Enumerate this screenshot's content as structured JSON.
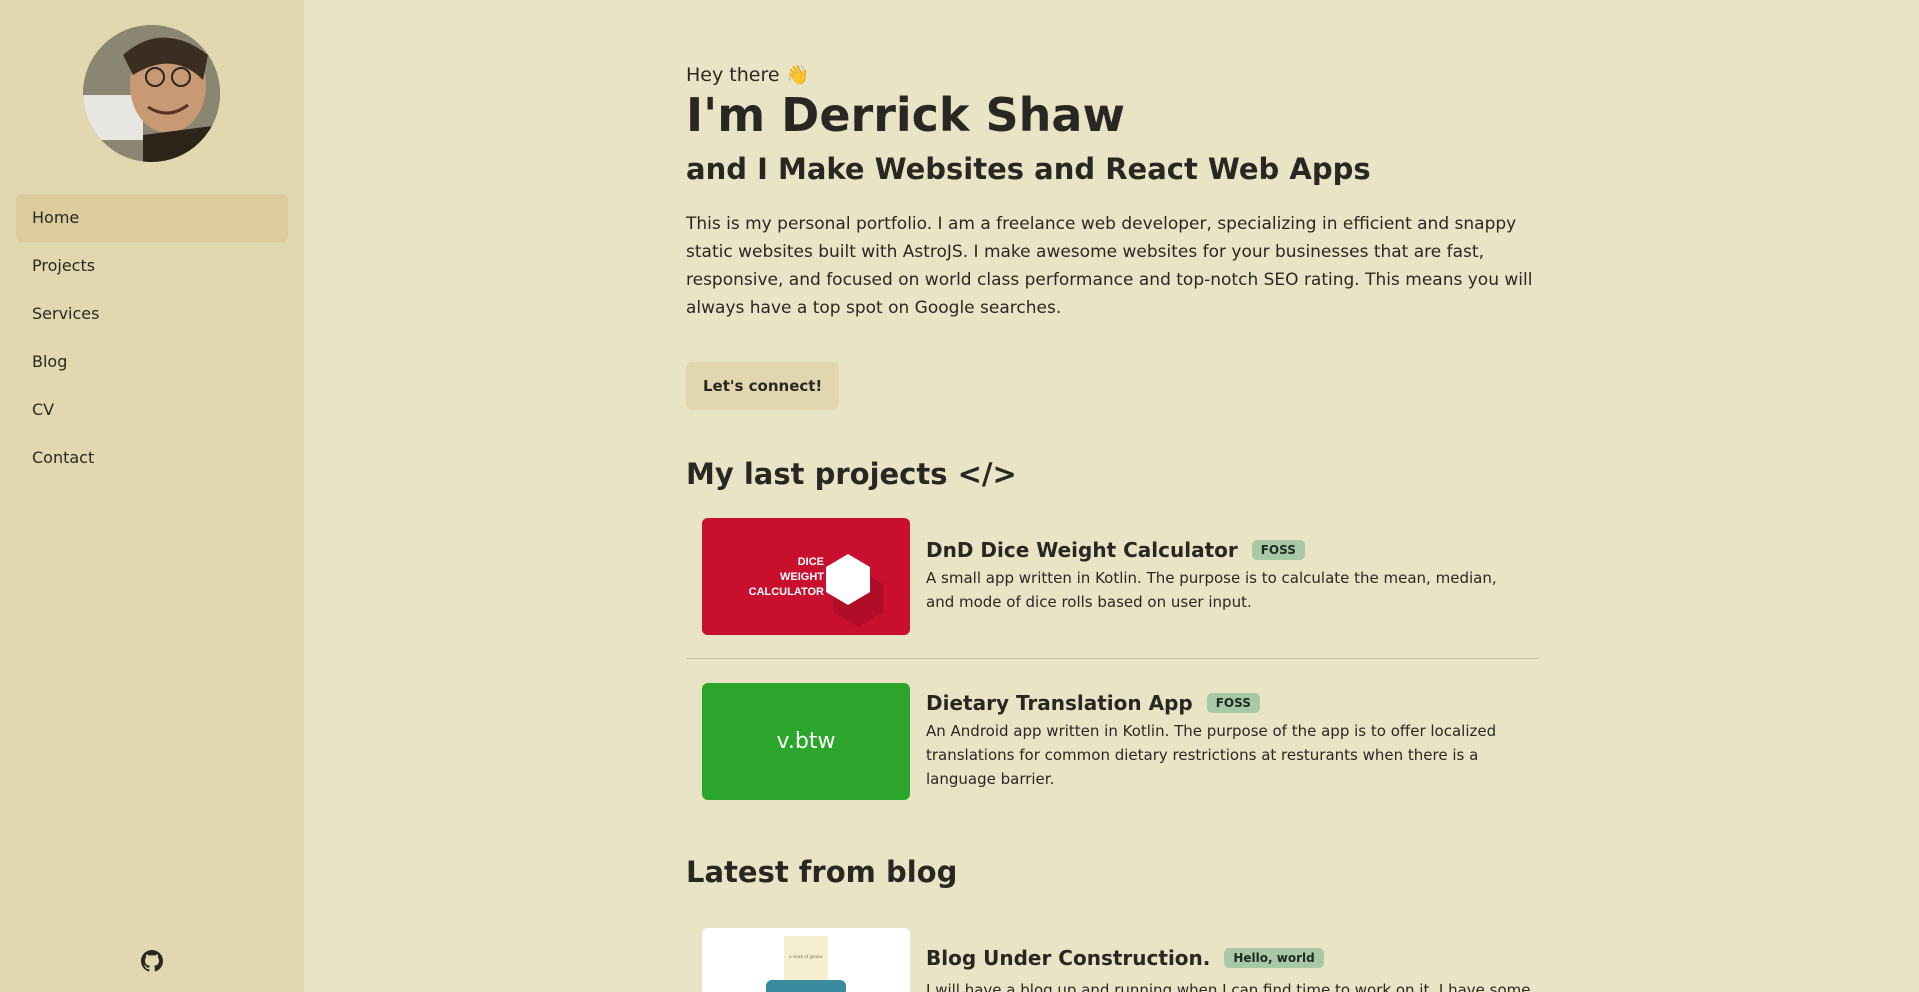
{
  "sidebar": {
    "nav": [
      {
        "label": "Home",
        "active": true
      },
      {
        "label": "Projects",
        "active": false
      },
      {
        "label": "Services",
        "active": false
      },
      {
        "label": "Blog",
        "active": false
      },
      {
        "label": "CV",
        "active": false
      },
      {
        "label": "Contact",
        "active": false
      }
    ]
  },
  "hero": {
    "greeting": "Hey there 👋",
    "name": "I'm Derrick Shaw",
    "tagline": "and I Make Websites and React Web Apps",
    "intro": "This is my personal portfolio. I am a freelance web developer, specializing in efficient and snappy static websites built with AstroJS. I make awesome websites for your businesses that are fast, responsive, and focused on world class performance and top-notch SEO rating. This means you will always have a top spot on Google searches.",
    "cta_label": "Let's connect!"
  },
  "projects": {
    "heading": "My last projects </>",
    "items": [
      {
        "title": "DnD Dice Weight Calculator",
        "badge": "FOSS",
        "description": "A small app written in Kotlin. The purpose is to calculate the mean, median, and mode of dice rolls based on user input.",
        "thumb_text": [
          "DICE",
          "WEIGHT",
          "CALCULATOR"
        ],
        "thumb_color": "#c8102e"
      },
      {
        "title": "Dietary Translation App",
        "badge": "FOSS",
        "description": "An Android app written in Kotlin. The purpose of the app is to offer localized translations for common dietary restrictions at resturants when there is a language barrier.",
        "thumb_text": "v.btw",
        "thumb_color": "#2ba52b"
      }
    ]
  },
  "blog": {
    "heading": "Latest from blog",
    "items": [
      {
        "title": "Blog Under Construction.",
        "badge": "Hello, world",
        "description": "I will have a blog up and running when I can find time to work on it. I have some",
        "thumb_caption": "a work of genius"
      }
    ]
  }
}
